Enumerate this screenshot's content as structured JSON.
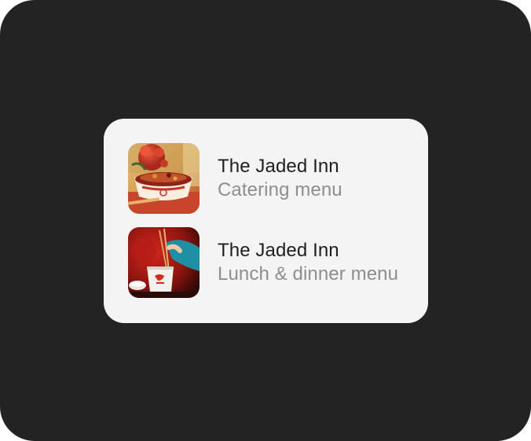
{
  "menus": {
    "items": [
      {
        "title": "The Jaded Inn",
        "subtitle": "Catering menu",
        "image_icon": "catering-noodle-bowl-photo"
      },
      {
        "title": "The Jaded Inn",
        "subtitle": "Lunch & dinner menu",
        "image_icon": "takeout-box-chopsticks-photo"
      }
    ]
  },
  "colors": {
    "background": "#232323",
    "card": "#f4f4f4",
    "title": "#1f1f1f",
    "subtitle": "#8e8e8e"
  }
}
